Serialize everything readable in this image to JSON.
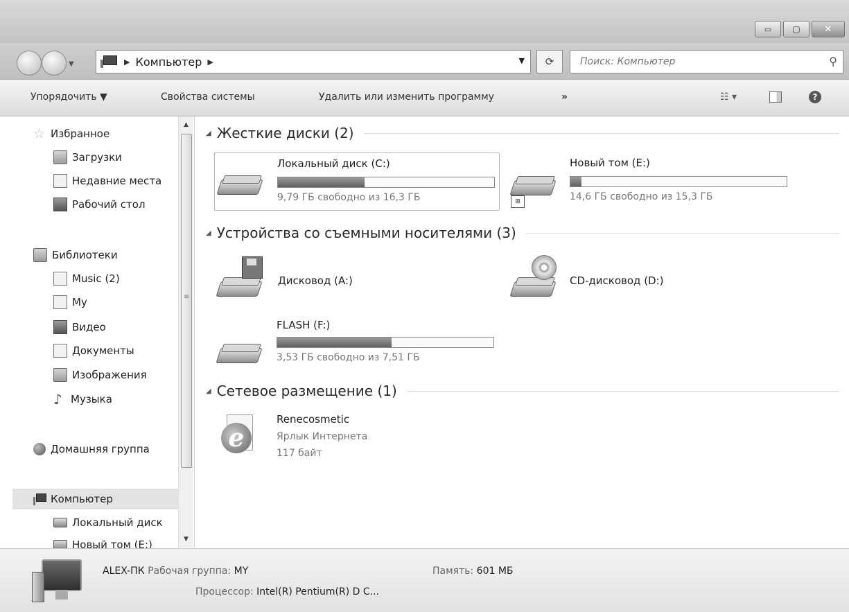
{
  "window": {
    "controls": {
      "minimize": "▭",
      "maximize": "▢",
      "close": "✕"
    }
  },
  "address": {
    "path": "Компьютер",
    "search_placeholder": "Поиск: Компьютер"
  },
  "toolbar": {
    "organize": "Упорядочить ▼",
    "system_properties": "Свойства системы",
    "uninstall": "Удалить или изменить программу",
    "more": "»"
  },
  "sidebar": {
    "items": [
      {
        "label": "Избранное",
        "icon": "star-icon"
      },
      {
        "label": "Загрузки",
        "icon": "downloads-icon"
      },
      {
        "label": "Недавние места",
        "icon": "recent-places-icon"
      },
      {
        "label": "Рабочий стол",
        "icon": "desktop-icon"
      },
      {
        "label": "Библиотеки",
        "icon": "libraries-icon"
      },
      {
        "label": "Music (2)",
        "icon": "library-icon"
      },
      {
        "label": "My",
        "icon": "library-icon"
      },
      {
        "label": "Видео",
        "icon": "video-icon"
      },
      {
        "label": "Документы",
        "icon": "documents-icon"
      },
      {
        "label": "Изображения",
        "icon": "pictures-icon"
      },
      {
        "label": "Музыка",
        "icon": "music-icon"
      },
      {
        "label": "Домашняя группа",
        "icon": "homegroup-icon"
      },
      {
        "label": "Компьютер",
        "icon": "computer-icon"
      },
      {
        "label": "Локальный диск",
        "icon": "drive-icon"
      },
      {
        "label": "Новый том (E:)",
        "icon": "drive-icon"
      }
    ]
  },
  "groups": {
    "hard_disks": "Жесткие диски (2)",
    "removable": "Устройства со съемными носителями (3)",
    "network": "Сетевое размещение (1)"
  },
  "drives": {
    "c": {
      "name": "Локальный диск (C:)",
      "free": "9,79 ГБ свободно из 16,3 ГБ",
      "used_fraction": 0.4
    },
    "e": {
      "name": "Новый том (E:)",
      "free": "14,6 ГБ свободно из 15,3 ГБ",
      "used_fraction": 0.05
    },
    "a": {
      "name": "Дисковод (A:)"
    },
    "d": {
      "name": "CD-дисковод (D:)"
    },
    "f": {
      "name": "FLASH (F:)",
      "free": "3,53 ГБ свободно из 7,51 ГБ",
      "used_fraction": 0.53
    }
  },
  "network_item": {
    "name": "Renecosmetic",
    "type": "Ярлык Интернета",
    "size": "117 байт"
  },
  "details": {
    "computer_name": "ALEX-ПК",
    "workgroup_label": "Рабочая группа:",
    "workgroup": "MY",
    "memory_label": "Память:",
    "memory": "601 МБ",
    "processor_label": "Процессор:",
    "processor": "Intel(R) Pentium(R) D C..."
  }
}
